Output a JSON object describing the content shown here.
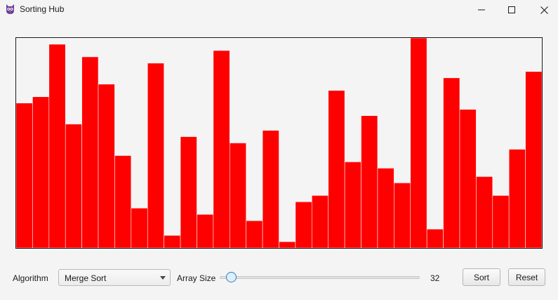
{
  "window": {
    "title": "Sorting Hub",
    "icon": "owl-logo-icon"
  },
  "controls": {
    "algorithm_label": "Algorithm",
    "algorithm_selected": "Merge Sort",
    "array_size_label": "Array Size",
    "array_size_value": "32",
    "array_size_fraction": 0.03,
    "sort_label": "Sort",
    "reset_label": "Reset"
  },
  "colors": {
    "bar_fill": "#ff0000",
    "bar_stroke": "#f5f5f5",
    "accent": "#2c7fc4",
    "canvas_border": "#1a1a1a"
  },
  "chart_data": {
    "type": "bar",
    "values": [
      69,
      72,
      97,
      59,
      91,
      78,
      44,
      19,
      88,
      6,
      53,
      16,
      94,
      50,
      13,
      56,
      3,
      22,
      25,
      75,
      41,
      63,
      38,
      31,
      100,
      9,
      81,
      66,
      34,
      25,
      47,
      84
    ],
    "ylim": [
      0,
      100
    ]
  }
}
